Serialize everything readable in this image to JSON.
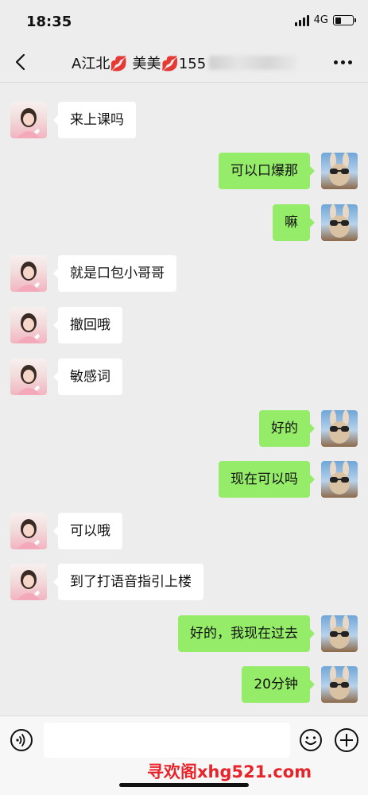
{
  "status_bar": {
    "time": "18:35",
    "network": "4G",
    "battery_level": 0.35
  },
  "nav": {
    "title": "A江北💋 美美💋155",
    "back_icon": "chevron-left-icon",
    "more_icon": "more-dots-icon"
  },
  "messages": [
    {
      "side": "left",
      "text": "来上课吗"
    },
    {
      "side": "right",
      "text": "可以口爆那"
    },
    {
      "side": "right",
      "text": "嘛"
    },
    {
      "side": "left",
      "text": "就是口包小哥哥"
    },
    {
      "side": "left",
      "text": "撤回哦"
    },
    {
      "side": "left",
      "text": "敏感词"
    },
    {
      "side": "right",
      "text": "好的"
    },
    {
      "side": "right",
      "text": "现在可以吗"
    },
    {
      "side": "left",
      "text": "可以哦"
    },
    {
      "side": "left",
      "text": "到了打语音指引上楼"
    },
    {
      "side": "right",
      "text": "好的，我现在过去"
    },
    {
      "side": "right",
      "text": "20分钟"
    }
  ],
  "input_bar": {
    "voice_icon": "voice-icon",
    "emoji_icon": "emoji-icon",
    "plus_icon": "plus-icon",
    "input_value": ""
  },
  "watermark": "寻欢阁xhg521.com",
  "colors": {
    "background": "#ededed",
    "bubble_self": "#95ec69",
    "bubble_other": "#ffffff",
    "watermark": "#e8242a"
  }
}
